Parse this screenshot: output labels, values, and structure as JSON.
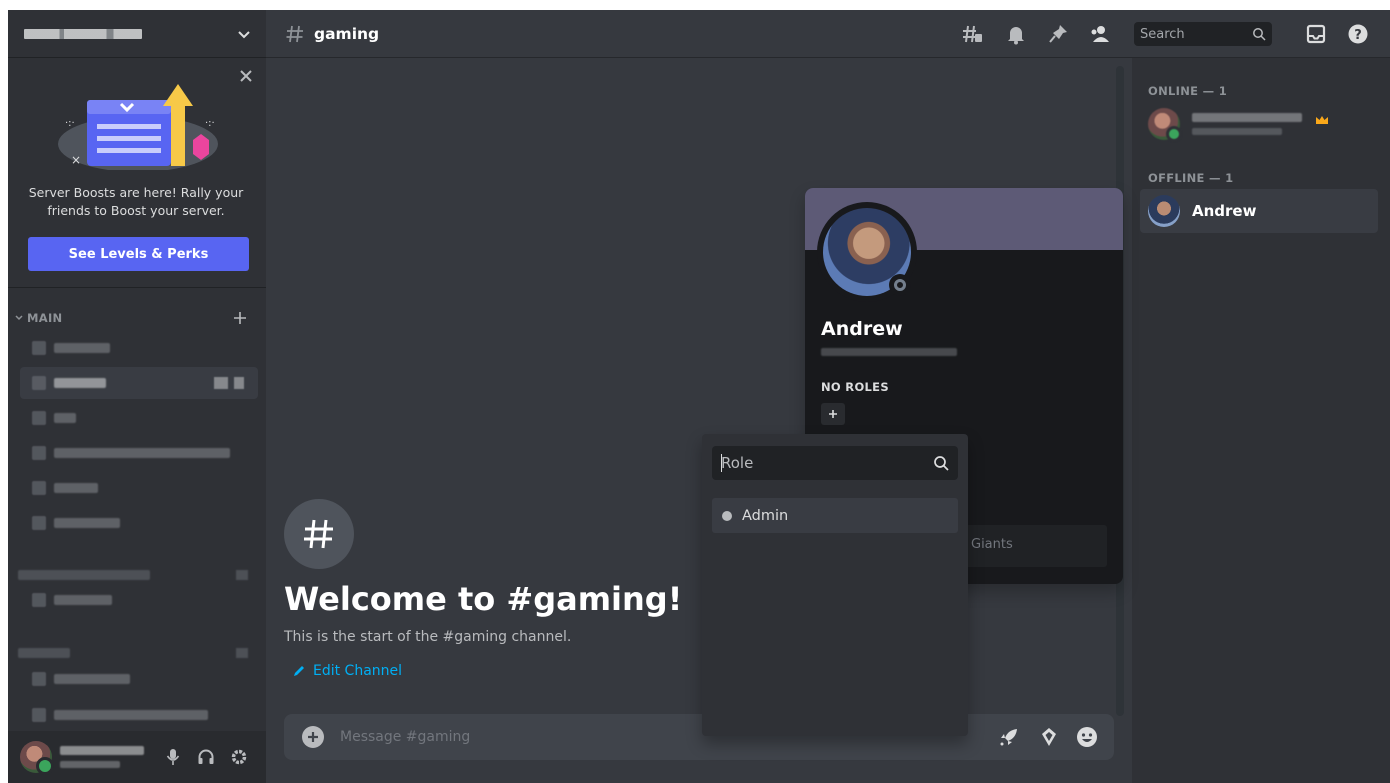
{
  "channel_header": {
    "title": "gaming",
    "search_placeholder": "Search"
  },
  "boost_panel": {
    "text": "Server Boosts are here! Rally your friends to Boost your server.",
    "button_label": "See Levels & Perks"
  },
  "sidebar": {
    "category_label": "MAIN"
  },
  "welcome": {
    "title": "Welcome to #gaming!",
    "subtitle": "This is the start of the #gaming channel.",
    "edit_label": "Edit Channel"
  },
  "composer": {
    "placeholder": "Message #gaming"
  },
  "members": {
    "online_label": "ONLINE — 1",
    "offline_label": "OFFLINE — 1",
    "offline_member": "Andrew"
  },
  "profile": {
    "name": "Andrew",
    "roles_label": "NO ROLES",
    "note_fragment": "Giants"
  },
  "role_picker": {
    "search_placeholder": "Role",
    "options": [
      "Admin"
    ]
  },
  "colors": {
    "accent": "#5865f2",
    "link": "#00aff4",
    "online": "#3ba55c",
    "banner": "#5d5a76"
  }
}
